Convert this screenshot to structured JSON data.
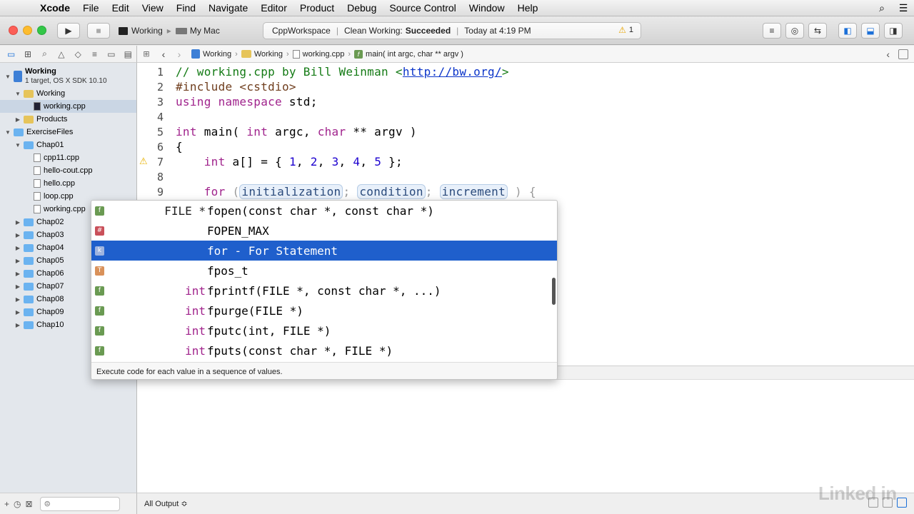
{
  "menubar": {
    "app_name": "Xcode",
    "items": [
      "File",
      "Edit",
      "View",
      "Find",
      "Navigate",
      "Editor",
      "Product",
      "Debug",
      "Source Control",
      "Window",
      "Help"
    ]
  },
  "toolbar": {
    "scheme": "Working",
    "destination": "My Mac",
    "activity_project": "CppWorkspace",
    "activity_status_prefix": "Clean Working:",
    "activity_status": "Succeeded",
    "activity_time": "Today at 4:19 PM",
    "warning_count": "1"
  },
  "jumpbar": {
    "items": [
      "Working",
      "Working",
      "working.cpp",
      "main( int argc, char ** argv )"
    ]
  },
  "navigator": {
    "project_name": "Working",
    "project_sub": "1 target, OS X SDK 10.10",
    "items": [
      {
        "label": "Working"
      },
      {
        "label": "working.cpp"
      },
      {
        "label": "Products"
      },
      {
        "label": "ExerciseFiles"
      },
      {
        "label": "Chap01"
      },
      {
        "label": "cpp11.cpp"
      },
      {
        "label": "hello-cout.cpp"
      },
      {
        "label": "hello.cpp"
      },
      {
        "label": "loop.cpp"
      },
      {
        "label": "working.cpp"
      },
      {
        "label": "Chap02"
      },
      {
        "label": "Chap03"
      },
      {
        "label": "Chap04"
      },
      {
        "label": "Chap05"
      },
      {
        "label": "Chap06"
      },
      {
        "label": "Chap07"
      },
      {
        "label": "Chap08"
      },
      {
        "label": "Chap09"
      },
      {
        "label": "Chap10"
      }
    ]
  },
  "editor": {
    "line_numbers": [
      "1",
      "2",
      "3",
      "4",
      "5",
      "6",
      "7",
      "8",
      "9"
    ],
    "line1_comment": "// working.cpp by Bill Weinman <",
    "line1_url": "http://bw.org/",
    "line1_end": ">",
    "line2_pp": "#include <cstdio>",
    "line3_kw": "using namespace",
    "line3_rest": " std;",
    "line5_kw1": "int",
    "line5_mid1": " main( ",
    "line5_kw2": "int",
    "line5_mid2": " argc, ",
    "line5_kw3": "char",
    "line5_end": " ** argv )",
    "line6": "{",
    "line7_kw": "int",
    "line7_mid": " a[] = { ",
    "line7_nums": [
      "1",
      "2",
      "3",
      "4",
      "5"
    ],
    "line7_end": " };",
    "line9_for": "for",
    "line9_open": " (",
    "line9_ph1": "initialization",
    "line9_ph2": "condition",
    "line9_ph3": "increment",
    "line9_end": ") {"
  },
  "completion": {
    "items": [
      {
        "type": "FILE *",
        "name": "fopen(const char *, const char *)",
        "icon": "f"
      },
      {
        "type": "",
        "name": "FOPEN_MAX",
        "icon": "#"
      },
      {
        "type": "",
        "name": "for - For Statement",
        "icon": "k"
      },
      {
        "type": "",
        "name": "fpos_t",
        "icon": "T"
      },
      {
        "type": "int",
        "name": "fprintf(FILE *, const char *, ...)",
        "icon": "f"
      },
      {
        "type": "int",
        "name": "fpurge(FILE *)",
        "icon": "f"
      },
      {
        "type": "int",
        "name": "fputc(int, FILE *)",
        "icon": "f"
      },
      {
        "type": "int",
        "name": "fputs(const char *, FILE *)",
        "icon": "f"
      }
    ],
    "description": "Execute code for each value in a sequence of values."
  },
  "debug": {
    "output_selector": "All Output ≎"
  },
  "watermark": "Linked in"
}
